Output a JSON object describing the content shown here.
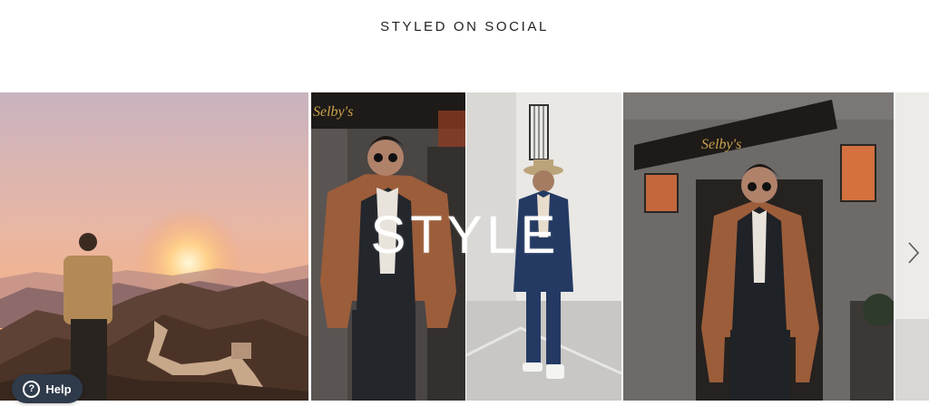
{
  "section": {
    "title": "STYLED ON SOCIAL"
  },
  "gallery": {
    "overlay_text": "STYLE",
    "tiles": [
      {
        "name": "great-wall-sunset-photo"
      },
      {
        "name": "brown-coat-selbys-photo"
      },
      {
        "name": "navy-suit-hat-photo"
      },
      {
        "name": "brown-coat-awning-photo"
      },
      {
        "name": "partial-next-photo"
      }
    ],
    "sign_text": "Selby's",
    "next_icon": "chevron-right-icon"
  },
  "help": {
    "label": "Help",
    "icon_glyph": "?",
    "icon": "question-circle-icon",
    "background_color": "#2f3a4a"
  }
}
